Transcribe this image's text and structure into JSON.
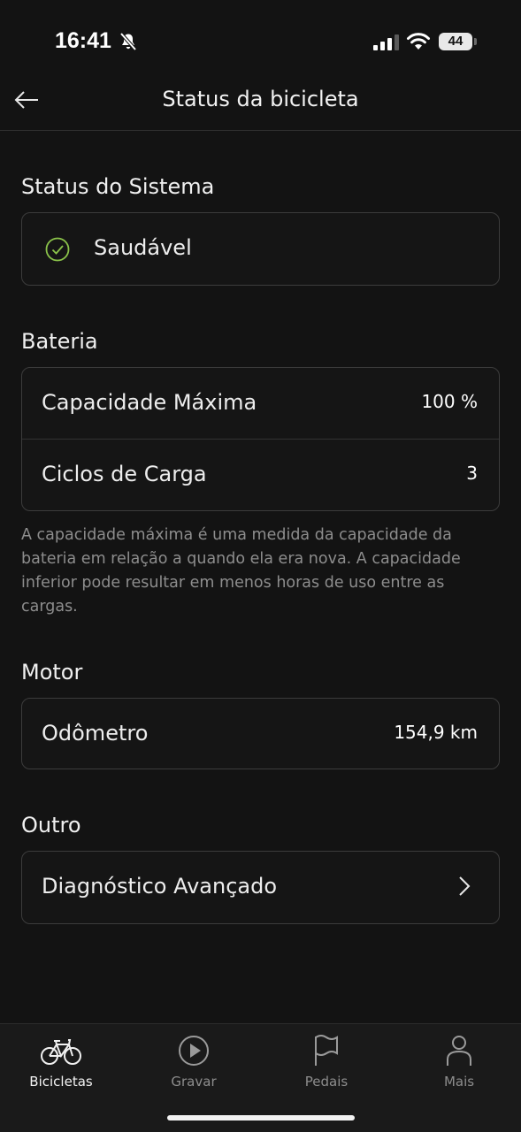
{
  "status_bar": {
    "time": "16:41",
    "battery_level": "44",
    "icons": [
      "bell-slash-icon",
      "cellular-signal-icon",
      "wifi-icon",
      "battery-icon"
    ]
  },
  "nav": {
    "title": "Status da bicicleta",
    "back_icon": "arrow-left-icon"
  },
  "system_status": {
    "title": "Status do Sistema",
    "status": "Saudável",
    "status_icon": "check-circle-icon",
    "status_color": "#8bc34a"
  },
  "battery": {
    "title": "Bateria",
    "rows": [
      {
        "label": "Capacidade Máxima",
        "value": "100 %"
      },
      {
        "label": "Ciclos de Carga",
        "value": "3"
      }
    ],
    "note": "A capacidade máxima é uma medida da capacidade da bateria em relação a quando ela era nova. A capacidade inferior pode resultar em menos horas de uso entre as cargas."
  },
  "motor": {
    "title": "Motor",
    "rows": [
      {
        "label": "Odômetro",
        "value": "154,9 km"
      }
    ]
  },
  "other": {
    "title": "Outro",
    "rows": [
      {
        "label": "Diagnóstico Avançado",
        "icon": "chevron-right-icon"
      }
    ]
  },
  "tabbar": {
    "items": [
      {
        "label": "Bicicletas",
        "icon": "bicycle-icon",
        "active": true
      },
      {
        "label": "Gravar",
        "icon": "play-circle-icon",
        "active": false
      },
      {
        "label": "Pedais",
        "icon": "flag-icon",
        "active": false
      },
      {
        "label": "Mais",
        "icon": "person-icon",
        "active": false
      }
    ]
  },
  "colors": {
    "background": "#131313",
    "card_border": "#3c3c3c",
    "accent_green": "#8bc34a",
    "muted_text": "#8d8d8d"
  }
}
